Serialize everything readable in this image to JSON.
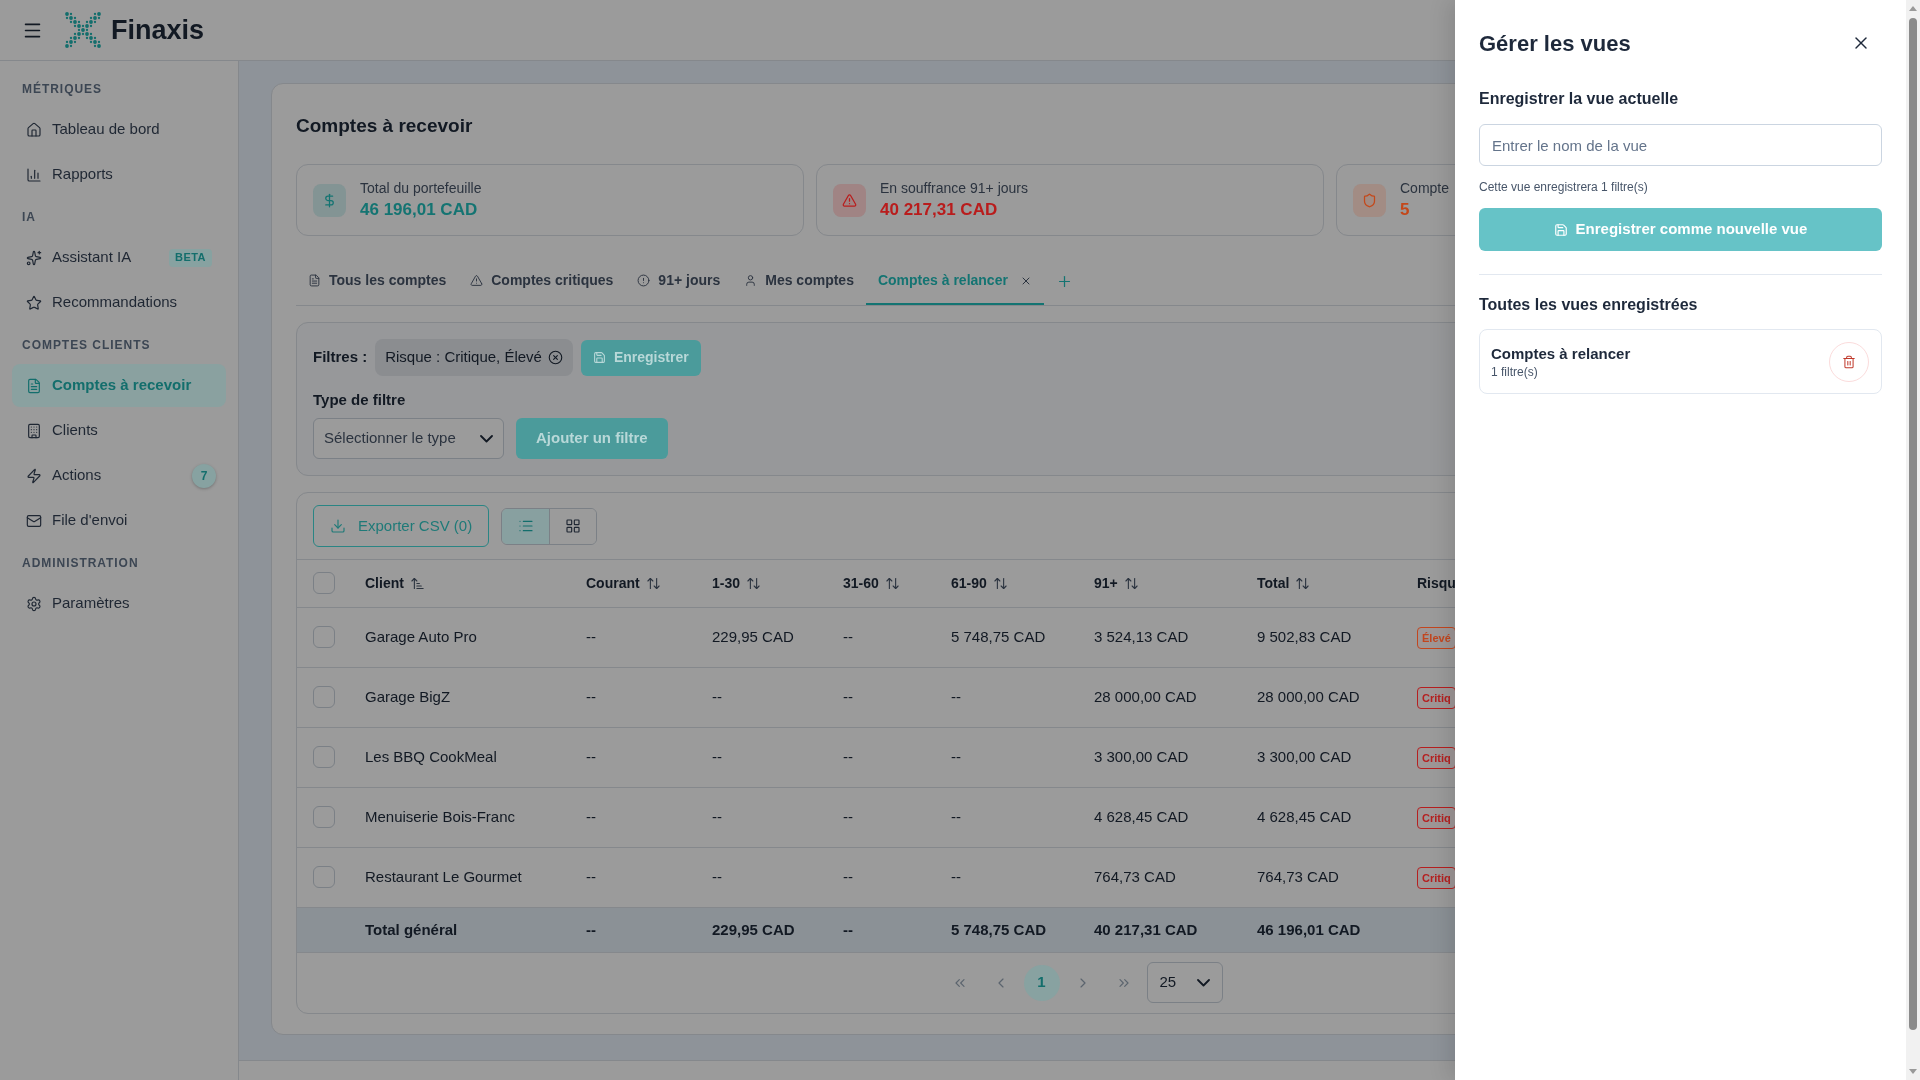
{
  "header": {
    "brand": "Finaxis"
  },
  "sidebar": {
    "sections": [
      {
        "heading": "MÉTRIQUES",
        "items": [
          {
            "label": "Tableau de bord",
            "selected": false
          },
          {
            "label": "Rapports",
            "selected": false
          }
        ]
      },
      {
        "heading": "IA",
        "items": [
          {
            "label": "Assistant IA",
            "selected": false,
            "badge": {
              "kind": "tag",
              "text": "BETA"
            }
          },
          {
            "label": "Recommandations",
            "selected": false
          }
        ]
      },
      {
        "heading": "COMPTES CLIENTS",
        "items": [
          {
            "label": "Comptes à recevoir",
            "selected": true
          },
          {
            "label": "Clients",
            "selected": false
          },
          {
            "label": "Actions",
            "selected": false,
            "badge": {
              "kind": "count",
              "text": "7"
            }
          },
          {
            "label": "File d'envoi",
            "selected": false
          }
        ]
      },
      {
        "heading": "ADMINISTRATION",
        "items": [
          {
            "label": "Paramètres",
            "selected": false
          }
        ]
      }
    ]
  },
  "page": {
    "title": "Comptes à recevoir",
    "stats": [
      {
        "label": "Total du portefeuille",
        "value": "46 196,01 CAD",
        "color": "#147472"
      },
      {
        "label": "En souffrance 91+ jours",
        "value": "40 217,31 CAD",
        "color": "#b91c1c"
      },
      {
        "label": "Compte",
        "value": "5",
        "color": "#c4481a"
      }
    ],
    "tabs": [
      {
        "label": "Tous les comptes",
        "selected": false,
        "closable": false
      },
      {
        "label": "Comptes critiques",
        "selected": false,
        "closable": false
      },
      {
        "label": "91+ jours",
        "selected": false,
        "closable": false
      },
      {
        "label": "Mes comptes",
        "selected": false,
        "closable": false
      },
      {
        "label": "Comptes à relancer",
        "selected": true,
        "closable": true
      }
    ],
    "filters": {
      "label": "Filtres :",
      "chips": [
        {
          "text": "Risque : Critique, Élevé"
        }
      ],
      "save_button": "Enregistrer",
      "type_label": "Type de filtre",
      "type_select": {
        "placeholder": "Sélectionner le type"
      },
      "add_button": "Ajouter un filtre"
    },
    "toolbar": {
      "export_button": "Exporter CSV (0)",
      "view_modes": [
        {
          "kind": "list",
          "selected": true
        },
        {
          "kind": "grid",
          "selected": false
        }
      ]
    },
    "table": {
      "all_checked": false,
      "columns": [
        {
          "label": "Client",
          "sorted": true
        },
        {
          "label": "Courant",
          "sorted": false
        },
        {
          "label": "1-30",
          "sorted": false
        },
        {
          "label": "31-60",
          "sorted": false
        },
        {
          "label": "61-90",
          "sorted": false
        },
        {
          "label": "91+",
          "sorted": false
        },
        {
          "label": "Total",
          "sorted": false
        },
        {
          "label": "Risqu"
        }
      ],
      "rows": [
        {
          "checked": false,
          "cells": [
            "Garage Auto Pro",
            "--",
            "229,95 CAD",
            "--",
            "5 748,75 CAD",
            "3 524,13 CAD",
            "9 502,83 CAD"
          ],
          "risk": {
            "label": "Élevé",
            "color": "#c2461f"
          }
        },
        {
          "checked": false,
          "cells": [
            "Garage BigZ",
            "--",
            "--",
            "--",
            "--",
            "28 000,00 CAD",
            "28 000,00 CAD"
          ],
          "risk": {
            "label": "Critiq",
            "color": "#b52020"
          }
        },
        {
          "checked": false,
          "cells": [
            "Les BBQ CookMeal",
            "--",
            "--",
            "--",
            "--",
            "3 300,00 CAD",
            "3 300,00 CAD"
          ],
          "risk": {
            "label": "Critiq",
            "color": "#b52020"
          }
        },
        {
          "checked": false,
          "cells": [
            "Menuiserie Bois-Franc",
            "--",
            "--",
            "--",
            "--",
            "4 628,45 CAD",
            "4 628,45 CAD"
          ],
          "risk": {
            "label": "Critiq",
            "color": "#b52020"
          }
        },
        {
          "checked": false,
          "cells": [
            "Restaurant Le Gourmet",
            "--",
            "--",
            "--",
            "--",
            "764,73 CAD",
            "764,73 CAD"
          ],
          "risk": {
            "label": "Critiq",
            "color": "#b52020"
          }
        }
      ],
      "total_row": {
        "cells": [
          "Total général",
          "--",
          "229,95 CAD",
          "--",
          "5 748,75 CAD",
          "40 217,31 CAD",
          "46 196,01 CAD"
        ]
      }
    },
    "pagination": {
      "pages": [
        {
          "label": "1",
          "selected": true
        }
      ],
      "page_size": "25"
    }
  },
  "drawer": {
    "title": "Gérer les vues",
    "save_heading": "Enregistrer la vue actuelle",
    "name_field": {
      "placeholder": "Entrer le nom de la vue"
    },
    "hint": "Cette vue enregistrera 1 filtre(s)",
    "save_button": {
      "label": "Enregistrer comme nouvelle vue",
      "disabled": true
    },
    "saved_heading": "Toutes les vues enregistrées",
    "views": [
      {
        "name": "Comptes à relancer",
        "detail": "1 filtre(s)"
      }
    ]
  }
}
